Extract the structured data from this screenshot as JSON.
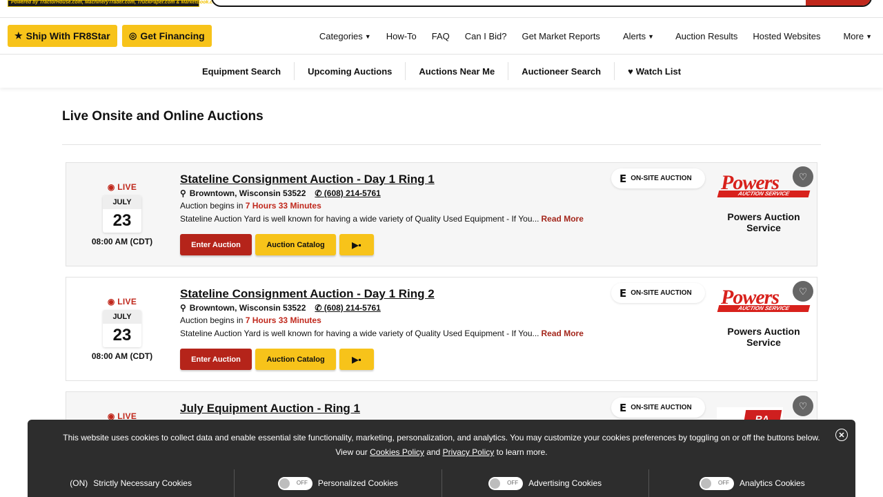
{
  "topbar": {
    "powered_by": "Powered by TractorHouse.com, MachineryTrader.com, TruckPaper.com & MarketBook.com"
  },
  "mainnav": {
    "ship_label": "Ship With FR8Star",
    "financing_label": "Get Financing",
    "items": [
      "Categories",
      "How-To",
      "FAQ",
      "Can I Bid?",
      "Get Market Reports",
      "Alerts",
      "Auction Results",
      "Hosted Websites",
      "More"
    ]
  },
  "subnav": {
    "items": [
      "Equipment Search",
      "Upcoming Auctions",
      "Auctions Near Me",
      "Auctioneer Search",
      "Watch List"
    ]
  },
  "page": {
    "title": "Live Onsite and Online Auctions"
  },
  "auctions": [
    {
      "live": "LIVE",
      "month": "JULY",
      "day": "23",
      "time": "08:00 AM (CDT)",
      "title": "Stateline Consignment Auction - Day 1 Ring 1",
      "location": "Browntown, Wisconsin 53522",
      "phone": "(608) 214-5761",
      "begins_prefix": "Auction begins in",
      "countdown": "7 Hours 33 Minutes",
      "description": "Stateline Auction Yard is well known for having a wide variety of Quality Used Equipment - If You...",
      "read_more": "Read More",
      "enter_label": "Enter Auction",
      "catalog_label": "Auction Catalog",
      "badge": "ON-SITE AUCTION",
      "logo_text": "Powers",
      "logo_sub": "AUCTION SERVICE",
      "auctioneer": "Powers Auction Service"
    },
    {
      "live": "LIVE",
      "month": "JULY",
      "day": "23",
      "time": "08:00 AM (CDT)",
      "title": "Stateline Consignment Auction - Day 1 Ring 2",
      "location": "Browntown, Wisconsin 53522",
      "phone": "(608) 214-5761",
      "begins_prefix": "Auction begins in",
      "countdown": "7 Hours 33 Minutes",
      "description": "Stateline Auction Yard is well known for having a wide variety of Quality Used Equipment - If You...",
      "read_more": "Read More",
      "enter_label": "Enter Auction",
      "catalog_label": "Auction Catalog",
      "badge": "ON-SITE AUCTION",
      "logo_text": "Powers",
      "logo_sub": "AUCTION SERVICE",
      "auctioneer": "Powers Auction Service"
    },
    {
      "live": "LIVE",
      "title": "July Equipment Auction - Ring 1",
      "badge": "ON-SITE AUCTION",
      "logo_text": "RA"
    }
  ],
  "cookie": {
    "text_line1": "This website uses cookies to collect data and enable essential site functionality, marketing, personalization, and analytics. You may customize your cookies preferences by toggling on or off the buttons below.",
    "view_our": "View our",
    "cookies_policy": "Cookies Policy",
    "and": "and",
    "privacy_policy": "Privacy Policy",
    "learn_more": "to learn more.",
    "options": [
      {
        "state": "(ON)",
        "label": "Strictly Necessary Cookies"
      },
      {
        "state": "OFF",
        "label": "Personalized Cookies"
      },
      {
        "state": "OFF",
        "label": "Advertising Cookies"
      },
      {
        "state": "OFF",
        "label": "Analytics Cookies"
      }
    ]
  },
  "colors": {
    "accent_yellow": "#f7c31a",
    "accent_red": "#b5241a",
    "live_red": "#c0281c",
    "cookie_bg": "#2d2d2d"
  }
}
